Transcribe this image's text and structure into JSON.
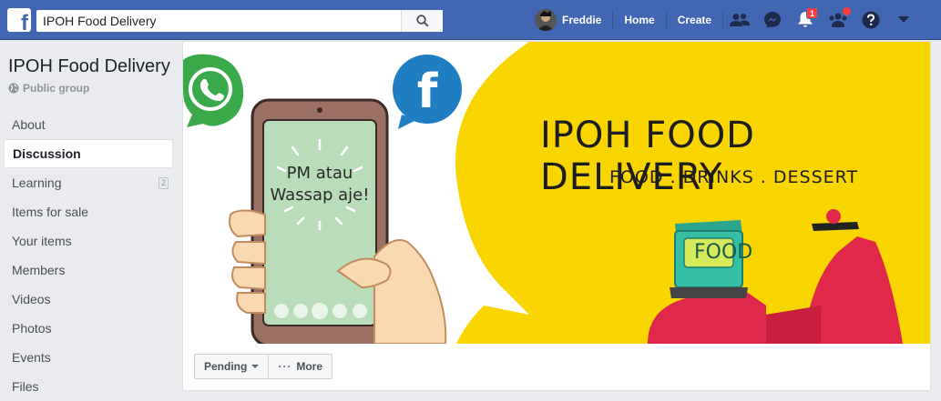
{
  "topbar": {
    "search_value": "IPOH Food Delivery",
    "user_name": "Freddie",
    "home_label": "Home",
    "create_label": "Create",
    "notifications_count": "1",
    "icons": [
      "friend-requests-icon",
      "messenger-icon",
      "notifications-icon",
      "groups-icon",
      "help-icon",
      "account-menu-icon"
    ],
    "brand_color": "#4267b2"
  },
  "sidebar": {
    "title": "IPOH Food Delivery",
    "privacy": "Public group",
    "items": [
      {
        "label": "About",
        "count": ""
      },
      {
        "label": "Discussion",
        "count": ""
      },
      {
        "label": "Learning",
        "count": "2"
      },
      {
        "label": "Items for sale",
        "count": ""
      },
      {
        "label": "Your items",
        "count": ""
      },
      {
        "label": "Members",
        "count": ""
      },
      {
        "label": "Videos",
        "count": ""
      },
      {
        "label": "Photos",
        "count": ""
      },
      {
        "label": "Events",
        "count": ""
      },
      {
        "label": "Files",
        "count": ""
      }
    ]
  },
  "cover": {
    "title": "IPOH FOOD DELIVERY",
    "subtitle": "FOOD . DRINKS . DESSERT",
    "phone_message_line1": "PM atau",
    "phone_message_line2": "Wassap aje!",
    "box_label": "FOOD",
    "accent_yellow": "#f9d500",
    "scooter_red": "#e0284a"
  },
  "actions": {
    "pending_label": "Pending",
    "more_label": "More"
  }
}
